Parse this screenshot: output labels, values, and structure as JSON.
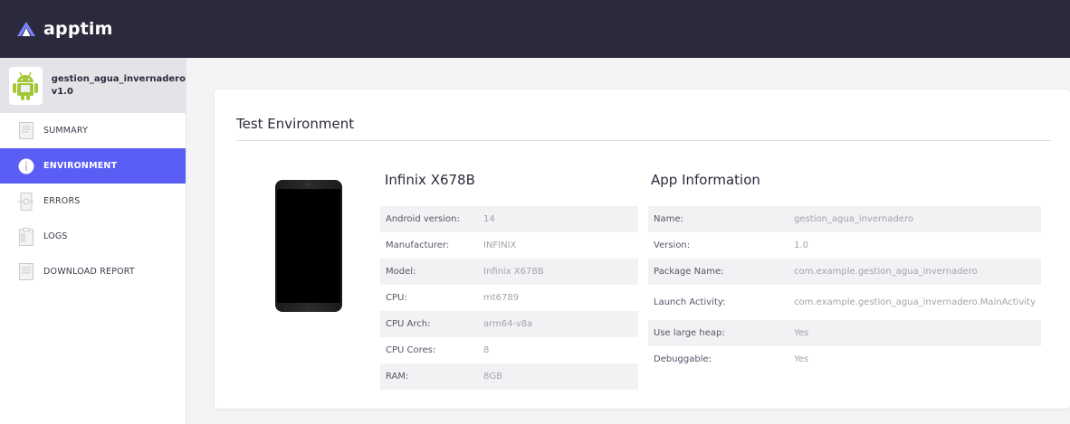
{
  "header": {
    "brand": "apptim"
  },
  "app": {
    "name": "gestion_agua_invernadero",
    "version": "v1.0"
  },
  "sidebar": {
    "items": [
      {
        "label": "SUMMARY",
        "icon": "summary-icon",
        "active": false
      },
      {
        "label": "ENVIRONMENT",
        "icon": "info-icon",
        "active": true
      },
      {
        "label": "ERRORS",
        "icon": "errors-icon",
        "active": false
      },
      {
        "label": "LOGS",
        "icon": "logs-icon",
        "active": false
      },
      {
        "label": "DOWNLOAD REPORT",
        "icon": "download-report-icon",
        "active": false
      }
    ]
  },
  "main": {
    "title": "Test Environment",
    "device": {
      "title": "Infinix X678B",
      "rows": [
        {
          "key": "Android version:",
          "value": "14"
        },
        {
          "key": "Manufacturer:",
          "value": "INFINIX"
        },
        {
          "key": "Model:",
          "value": "Infinix X678B"
        },
        {
          "key": "CPU:",
          "value": "mt6789"
        },
        {
          "key": "CPU Arch:",
          "value": "arm64-v8a"
        },
        {
          "key": "CPU Cores:",
          "value": "8"
        },
        {
          "key": "RAM:",
          "value": "8GB"
        }
      ]
    },
    "app_info": {
      "title": "App Information",
      "rows": [
        {
          "key": "Name:",
          "value": "gestion_agua_invernadero"
        },
        {
          "key": "Version:",
          "value": "1.0"
        },
        {
          "key": "Package Name:",
          "value": "com.example.gestion_agua_invernadero"
        },
        {
          "key": "Launch Activity:",
          "value": "com.example.gestion_agua_invernadero.MainActivity"
        },
        {
          "key": "Use large heap:",
          "value": "Yes"
        },
        {
          "key": "Debuggable:",
          "value": "Yes"
        }
      ]
    }
  },
  "colors": {
    "topbar": "#2b2a3c",
    "accent": "#5a5ef5",
    "android_green": "#a4c639"
  }
}
